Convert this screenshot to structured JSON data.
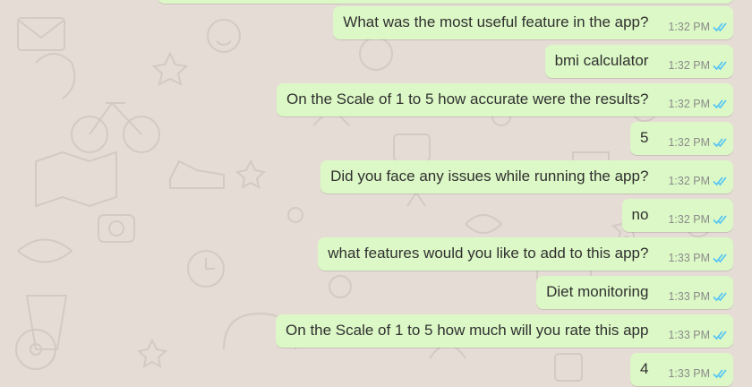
{
  "colors": {
    "background": "#e5ddd5",
    "outgoing_bubble": "#dcf8c6",
    "text": "#303030",
    "timestamp": "#8b8b8b",
    "read_ticks": "#4fc3f7"
  },
  "messages": [
    {
      "text": "What was the most useful feature in the app?",
      "time": "1:32 PM",
      "status_icon": "double-check-read-icon"
    },
    {
      "text": "bmi calculator",
      "time": "1:32 PM",
      "status_icon": "double-check-read-icon"
    },
    {
      "text": "On the Scale of 1 to 5 how accurate were the results?",
      "time": "1:32 PM",
      "status_icon": "double-check-read-icon"
    },
    {
      "text": "5",
      "time": "1:32 PM",
      "status_icon": "double-check-read-icon"
    },
    {
      "text": "Did you face any issues while running the app?",
      "time": "1:32 PM",
      "status_icon": "double-check-read-icon"
    },
    {
      "text": "no",
      "time": "1:32 PM",
      "status_icon": "double-check-read-icon"
    },
    {
      "text": "what features would you like to add to this app?",
      "time": "1:33 PM",
      "status_icon": "double-check-read-icon"
    },
    {
      "text": "Diet monitoring",
      "time": "1:33 PM",
      "status_icon": "double-check-read-icon"
    },
    {
      "text": "On the Scale of 1 to 5 how much will you rate this app",
      "time": "1:33 PM",
      "status_icon": "double-check-read-icon"
    },
    {
      "text": "4",
      "time": "1:33 PM",
      "status_icon": "double-check-read-icon"
    }
  ]
}
